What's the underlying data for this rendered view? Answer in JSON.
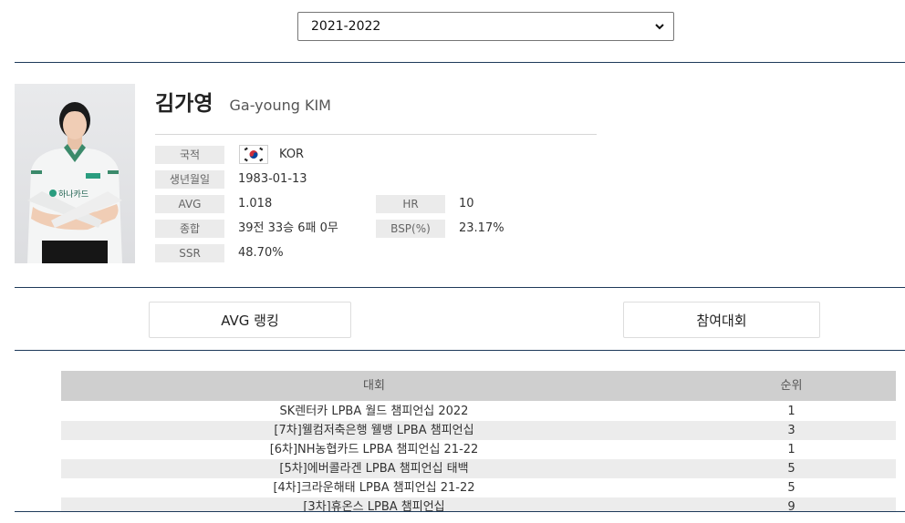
{
  "season_select": {
    "value": "2021-2022"
  },
  "player": {
    "name_ko": "김가영",
    "name_en": "Ga-young KIM",
    "photo_text": "하나카드"
  },
  "info": {
    "nationality_label": "국적",
    "nationality_value": "KOR",
    "birth_label": "생년월일",
    "birth_value": "1983-01-13",
    "avg_label": "AVG",
    "avg_value": "1.018",
    "hr_label": "HR",
    "hr_value": "10",
    "record_label": "종합",
    "record_value": "39전 33승 6패 0무",
    "bsp_label": "BSP(%)",
    "bsp_value": "23.17%",
    "ssr_label": "SSR",
    "ssr_value": "48.70%"
  },
  "buttons": {
    "avg_ranking": "AVG 랭킹",
    "tournaments": "참여대회"
  },
  "table": {
    "headers": {
      "tournament": "대회",
      "rank": "순위"
    },
    "rows": [
      {
        "tournament": "SK렌터카 LPBA 월드 챔피언십 2022",
        "rank": "1"
      },
      {
        "tournament": "[7차]웰컴저축은행 웰뱅 LPBA 챔피언십",
        "rank": "3"
      },
      {
        "tournament": "[6차]NH농협카드 LPBA 챔피언십 21-22",
        "rank": "1"
      },
      {
        "tournament": "[5차]에버콜라겐 LPBA 챔피언십 태백",
        "rank": "5"
      },
      {
        "tournament": "[4차]크라운해태 LPBA 챔피언십 21-22",
        "rank": "5"
      },
      {
        "tournament": "[3차]휴온스 LPBA 챔피언십",
        "rank": "9"
      }
    ]
  },
  "colors": {
    "divider": "#1e3a5a",
    "table_header_bg": "#cfcfcf",
    "label_bg": "#ebebeb"
  }
}
